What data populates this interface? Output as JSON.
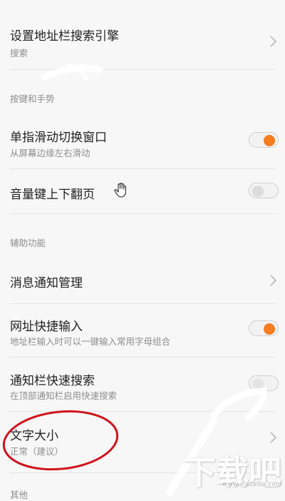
{
  "settings": {
    "search_engine": {
      "title": "设置地址栏搜索引擎",
      "subtitle": "搜索"
    },
    "section_keys": "按键和手势",
    "swipe_switch": {
      "title": "单指滑动切换窗口",
      "subtitle": "从屏幕边缘左右滑动",
      "enabled": true
    },
    "volume_page": {
      "title": "音量键上下翻页",
      "enabled": false
    },
    "section_assist": "辅助功能",
    "notification_manage": {
      "title": "消息通知管理"
    },
    "url_quick_input": {
      "title": "网址快捷输入",
      "subtitle": "地址栏输入时可以一键输入常用字母组合",
      "enabled": true
    },
    "notif_quick_search": {
      "title": "通知栏快速搜索",
      "subtitle": "在顶部通知栏启用快速搜索",
      "enabled": true
    },
    "text_size": {
      "title": "文字大小",
      "subtitle": "正常（建议）"
    },
    "section_other": "其他"
  },
  "colors": {
    "accent": "#f57c1f",
    "annotation_red": "#d0121b"
  },
  "icons": {
    "chevron": "chevron-right-icon",
    "cursor": "hand-cursor-icon"
  },
  "watermark": {
    "text": "下载吧",
    "url": "www.xiazaiba.com"
  }
}
